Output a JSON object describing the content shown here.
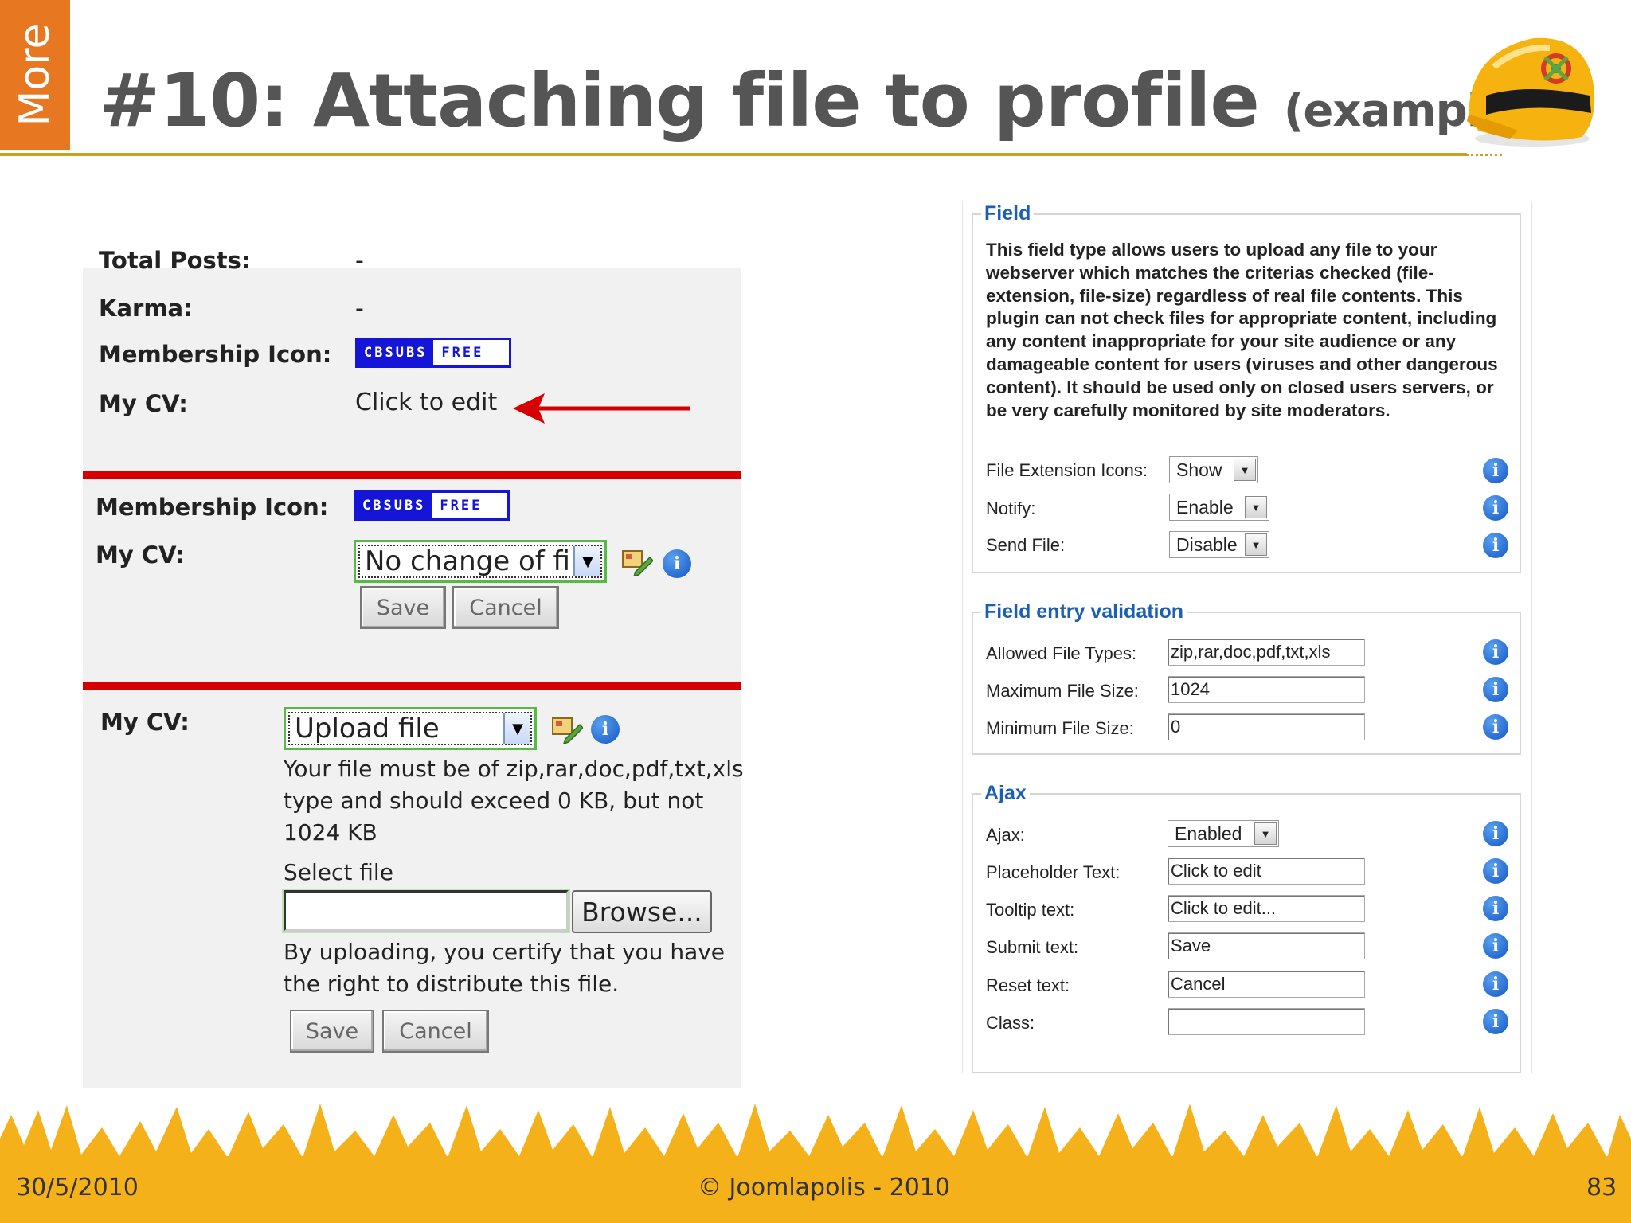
{
  "slide": {
    "tab_label": "More",
    "title": "#10: Attaching file to profile",
    "title_sub": "(example)",
    "date": "30/5/2010",
    "copyright": "© Joomlapolis - 2010",
    "page_number": "83"
  },
  "colors": {
    "accent_orange": "#e87722",
    "rule_gold": "#c8a21c",
    "separator_red": "#d60000",
    "link_blue": "#1a5fb4",
    "crowd_yellow": "#f5b11a"
  },
  "profile_view": {
    "total_posts_label": "Total Posts:",
    "total_posts_value": "-",
    "karma_label": "Karma:",
    "karma_value": "-",
    "membership_label": "Membership Icon:",
    "badge_left": "CBSUBS",
    "badge_right": "FREE",
    "cv_label": "My CV:",
    "cv_value": "Click to edit"
  },
  "profile_edit": {
    "membership_label": "Membership Icon:",
    "badge_left": "CBSUBS",
    "badge_right": "FREE",
    "cv_label": "My CV:",
    "select_value": "No change of file",
    "save_label": "Save",
    "cancel_label": "Cancel"
  },
  "profile_upload": {
    "cv_label": "My CV:",
    "select_value": "Upload file",
    "note_line1": "Your file must be of zip,rar,doc,pdf,txt,xls",
    "note_line2": "type and should exceed 0 KB, but not",
    "note_line3": "1024 KB",
    "select_file_label": "Select file",
    "file_input_value": "",
    "browse_label": "Browse...",
    "certify_line1": "By uploading, you certify that you have",
    "certify_line2": "the right to distribute this file.",
    "save_label": "Save",
    "cancel_label": "Cancel"
  },
  "field_settings": {
    "field_legend": "Field",
    "description": "This field type allows users to upload any file to your webserver which matches the criterias checked (file-extension, file-size) regardless of real file contents. This plugin can not check files for appropriate content, including any content inappropriate for your site audience or any damageable content for users (viruses and other dangerous content). It should be used only on closed users servers, or be very carefully monitored by site moderators.",
    "rows": [
      {
        "label": "File Extension Icons:",
        "value": "Show"
      },
      {
        "label": "Notify:",
        "value": "Enable"
      },
      {
        "label": "Send File:",
        "value": "Disable"
      }
    ],
    "validation_legend": "Field entry validation",
    "validation_rows": [
      {
        "label": "Allowed File Types:",
        "value": "zip,rar,doc,pdf,txt,xls"
      },
      {
        "label": "Maximum File Size:",
        "value": "1024"
      },
      {
        "label": "Minimum File Size:",
        "value": "0"
      }
    ],
    "ajax_legend": "Ajax",
    "ajax_label": "Ajax:",
    "ajax_value": "Enabled",
    "ajax_rows": [
      {
        "label": "Placeholder Text:",
        "value": "Click to edit"
      },
      {
        "label": "Tooltip text:",
        "value": "Click to edit..."
      },
      {
        "label": "Submit text:",
        "value": "Save"
      },
      {
        "label": "Reset text:",
        "value": "Cancel"
      },
      {
        "label": "Class:",
        "value": ""
      }
    ]
  },
  "icons": {
    "info": "info-icon",
    "edit": "edit-file-icon",
    "arrow": "red-arrow-icon",
    "hardhat": "hardhat-logo-icon",
    "dropdown": "chevron-down-icon"
  }
}
